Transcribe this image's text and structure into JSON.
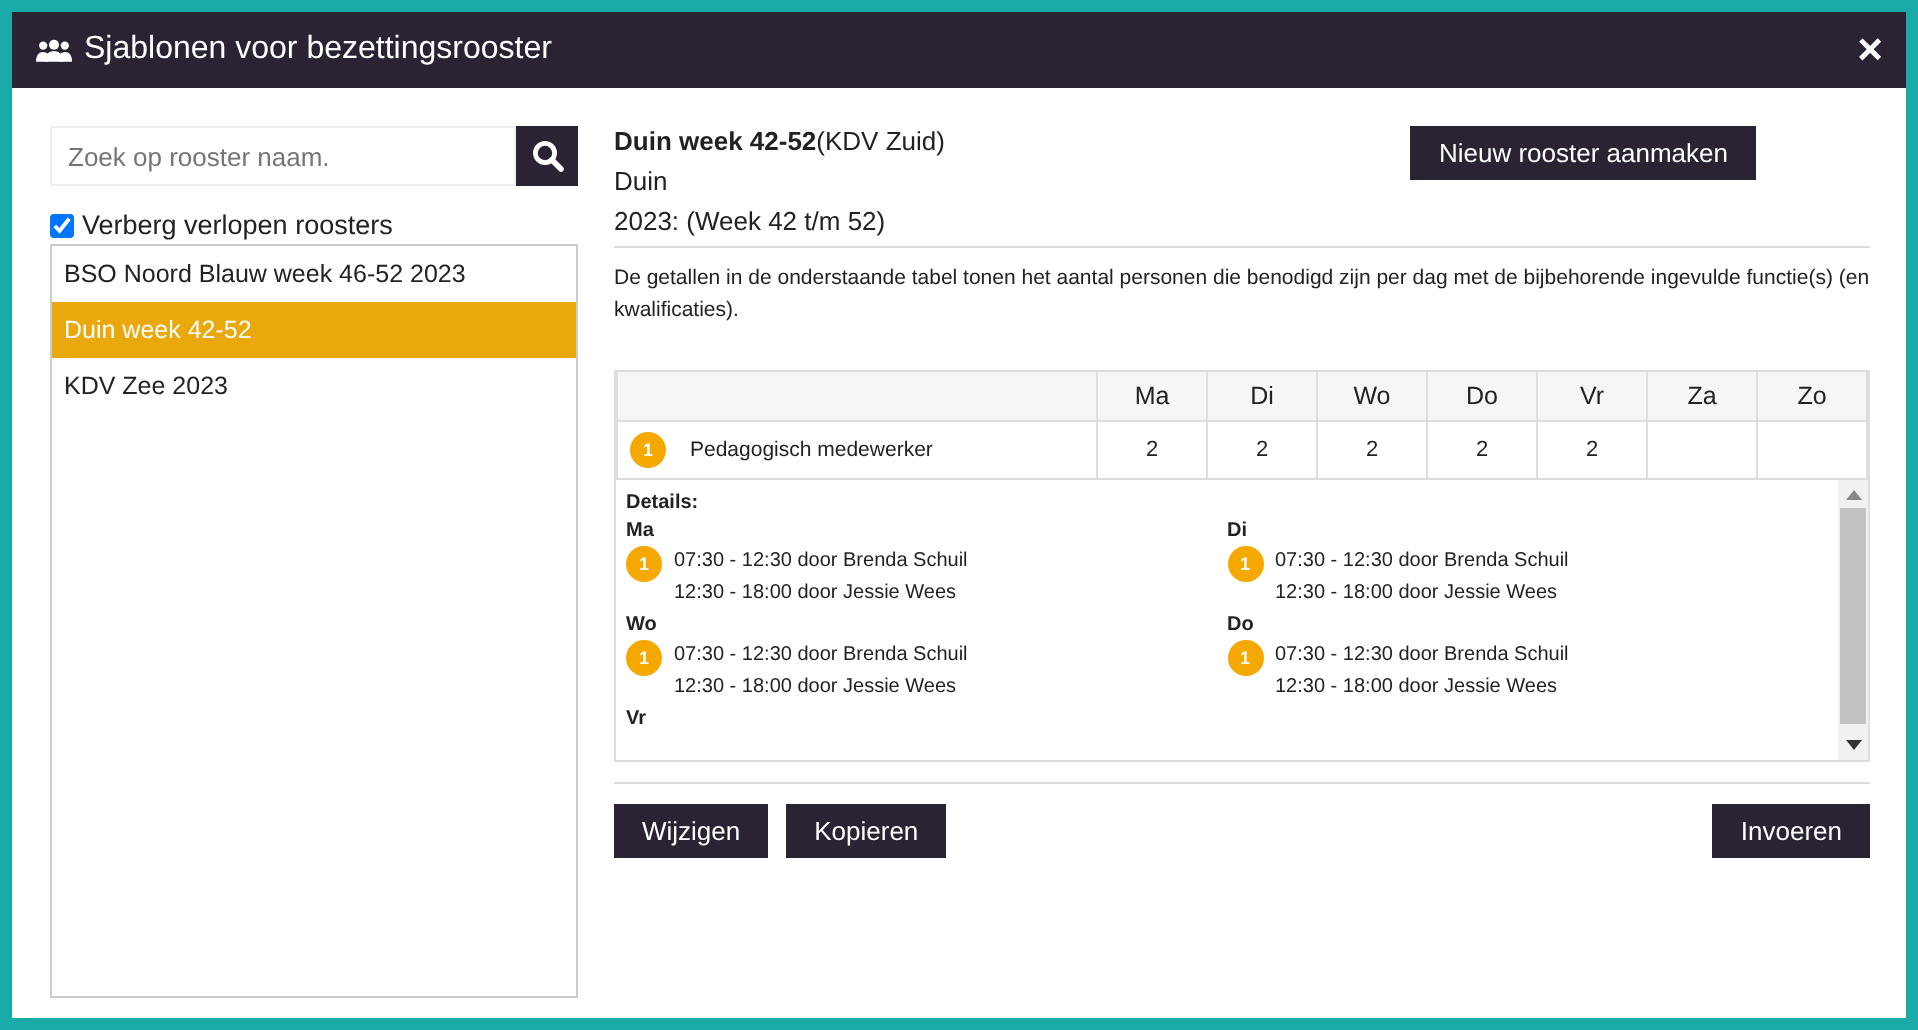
{
  "window": {
    "title": "Sjablonen voor bezettingsrooster",
    "close": "×"
  },
  "search": {
    "placeholder": "Zoek op rooster naam."
  },
  "hide_expired": {
    "label": "Verberg verlopen roosters",
    "checked": true
  },
  "schedules": [
    {
      "label": "BSO Noord Blauw week 46-52 2023",
      "selected": false
    },
    {
      "label": "Duin week 42-52",
      "selected": true
    },
    {
      "label": "KDV Zee 2023",
      "selected": false
    }
  ],
  "detail": {
    "name": "Duin week 42-52",
    "location": "(KDV Zuid)",
    "group": "Duin",
    "period": "2023: (Week 42 t/m 52)",
    "new_button": "Nieuw rooster aanmaken",
    "description": "De getallen in de onderstaande tabel tonen het aantal personen die benodigd zijn per dag met de bijbehorende ingevulde functie(s) (en kwalificaties)."
  },
  "table": {
    "columns": [
      "Ma",
      "Di",
      "Wo",
      "Do",
      "Vr",
      "Za",
      "Zo"
    ],
    "rows": [
      {
        "badge": "1",
        "function": "Pedagogisch medewerker",
        "cells": [
          "2",
          "2",
          "2",
          "2",
          "2",
          "",
          ""
        ]
      }
    ]
  },
  "details": {
    "title": "Details:",
    "days": [
      {
        "day": "Ma",
        "badge": "1",
        "lines": [
          "07:30 - 12:30 door Brenda Schuil",
          "12:30 - 18:00 door Jessie Wees"
        ]
      },
      {
        "day": "Di",
        "badge": "1",
        "lines": [
          "07:30 - 12:30 door Brenda Schuil",
          "12:30 - 18:00 door Jessie Wees"
        ]
      },
      {
        "day": "Wo",
        "badge": "1",
        "lines": [
          "07:30 - 12:30 door Brenda Schuil",
          "12:30 - 18:00 door Jessie Wees"
        ]
      },
      {
        "day": "Do",
        "badge": "1",
        "lines": [
          "07:30 - 12:30 door Brenda Schuil",
          "12:30 - 18:00 door Jessie Wees"
        ]
      },
      {
        "day": "Vr"
      }
    ]
  },
  "buttons": {
    "left": [
      "Wijzigen",
      "Kopieren"
    ],
    "right": "Invoeren"
  }
}
